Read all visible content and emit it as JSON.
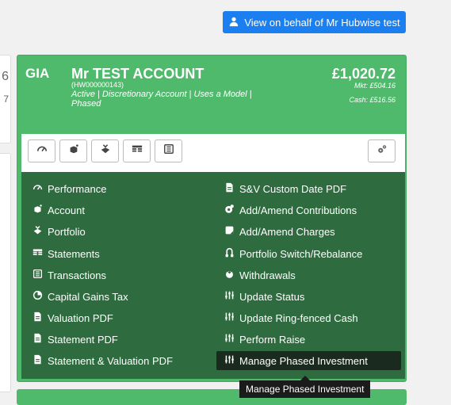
{
  "left_edge": {
    "top_char": "6",
    "mid_char": "7"
  },
  "view_behalf_button": {
    "label": "View on behalf of Mr Hubwise test"
  },
  "account": {
    "type": "GIA",
    "name": "Mr TEST ACCOUNT",
    "code": "(HW000000143)",
    "status": "Active | Discretionary Account | Uses a Model | Phased",
    "amount": "£1,020.72",
    "market": "Mkt: £504.16",
    "cash": "Cash: £516.56"
  },
  "menu": {
    "left": [
      "Performance",
      "Account",
      "Portfolio",
      "Statements",
      "Transactions",
      "Capital Gains Tax",
      "Valuation PDF",
      "Statement PDF",
      "Statement & Valuation PDF"
    ],
    "right": [
      "S&V Custom Date PDF",
      "Add/Amend Contributions",
      "Add/Amend Charges",
      "Portfolio Switch/Rebalance",
      "Withdrawals",
      "Update Status",
      "Update Ring-fenced Cash",
      "Perform Raise",
      "Manage Phased Investment"
    ]
  },
  "tooltip": {
    "text": "Manage Phased Investment"
  },
  "colors": {
    "primary": "#1b7ff0",
    "card": "#4fba6c",
    "menu": "#2e6b3e",
    "highlight": "#1a2a1f"
  }
}
